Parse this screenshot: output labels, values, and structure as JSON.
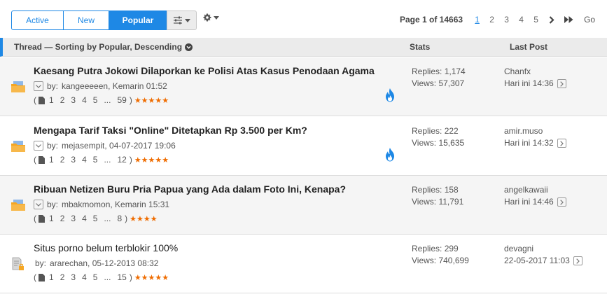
{
  "tabs": [
    {
      "label": "Active"
    },
    {
      "label": "New"
    },
    {
      "label": "Popular"
    }
  ],
  "pager": {
    "info": "Page 1 of 14663",
    "pages": [
      "1",
      "2",
      "3",
      "4",
      "5"
    ],
    "current": "1",
    "go": "Go"
  },
  "header": {
    "thread": "Thread — Sorting by Popular, Descending",
    "stats": "Stats",
    "last_post": "Last Post"
  },
  "threads": [
    {
      "title": "Kaesang Putra Jokowi Dilaporkan ke Polisi Atas Kasus Penodaan Agama",
      "by": "by:",
      "author_time": "kangeeeeen, Kemarin 01:52",
      "pages": [
        "1",
        "2",
        "3",
        "4",
        "5"
      ],
      "ellipsis": "...",
      "last_page": "59",
      "rating": "★★★★★",
      "hot": true,
      "replies": "Replies: 1,174",
      "views": "Views: 57,307",
      "last_user": "Chanfx",
      "last_time": "Hari ini 14:36"
    },
    {
      "title": "Mengapa Tarif Taksi \"Online\" Ditetapkan Rp 3.500 per Km?",
      "by": "by:",
      "author_time": "mejasempit, 04-07-2017 19:06",
      "pages": [
        "1",
        "2",
        "3",
        "4",
        "5"
      ],
      "ellipsis": "...",
      "last_page": "12",
      "rating": "★★★★★",
      "hot": true,
      "replies": "Replies: 222",
      "views": "Views: 15,635",
      "last_user": "amir.muso",
      "last_time": "Hari ini 14:32"
    },
    {
      "title": "Ribuan Netizen Buru Pria Papua yang Ada dalam Foto Ini, Kenapa?",
      "by": "by:",
      "author_time": "mbakmomon, Kemarin 15:31",
      "pages": [
        "1",
        "2",
        "3",
        "4",
        "5"
      ],
      "ellipsis": "...",
      "last_page": "8",
      "rating": "★★★★",
      "hot": false,
      "replies": "Replies: 158",
      "views": "Views: 11,791",
      "last_user": "angelkawaii",
      "last_time": "Hari ini 14:46"
    },
    {
      "title": "Situs porno belum terblokir 100%",
      "by": "by:",
      "author_time": "ararechan, 05-12-2013 08:32",
      "pages": [
        "1",
        "2",
        "3",
        "4",
        "5"
      ],
      "ellipsis": "...",
      "last_page": "15",
      "rating": "★★★★★",
      "hot": false,
      "replies": "Replies: 299",
      "views": "Views: 740,699",
      "last_user": "devagni",
      "last_time": "22-05-2017 11:03"
    }
  ],
  "colors": {
    "accent": "#1e88e5",
    "star": "#ef6c00",
    "hot": "#1e88e5",
    "folder": "#f5a623"
  }
}
